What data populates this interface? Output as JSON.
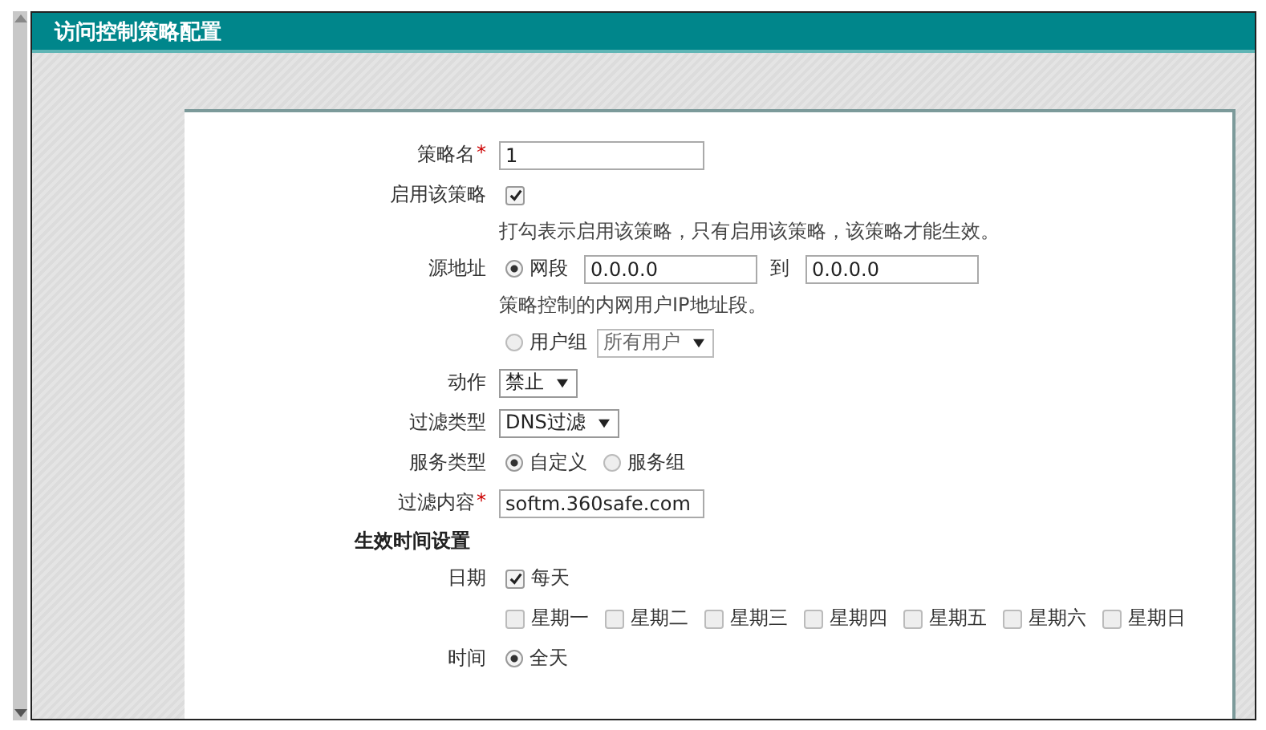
{
  "window": {
    "title": "访问控制策略配置"
  },
  "form": {
    "rows": [
      {
        "kind": "text_input",
        "label": "策略名",
        "required_mark": "*",
        "value": "1"
      },
      {
        "kind": "checkbox",
        "label": "启用该策略",
        "checked": true
      },
      {
        "kind": "hint",
        "text": "打勾表示启用该策略，只有启用该策略，该策略才能生效。"
      },
      {
        "kind": "range",
        "label": "源地址",
        "option": {
          "label": "网段",
          "selected": true
        },
        "from": "0.0.0.0",
        "to_label": "到",
        "to": "0.0.0.0"
      },
      {
        "kind": "hint",
        "text": "策略控制的内网用户IP地址段。"
      },
      {
        "kind": "radio_select",
        "option": {
          "label": "用户组",
          "selected": false
        },
        "value": "所有用户"
      },
      {
        "kind": "select",
        "label": "动作",
        "value": "禁止"
      },
      {
        "kind": "select",
        "label": "过滤类型",
        "value": "DNS过滤"
      },
      {
        "kind": "radio_group",
        "label": "服务类型",
        "options": [
          {
            "label": "自定义",
            "selected": true
          },
          {
            "label": "服务组",
            "selected": false
          }
        ]
      },
      {
        "kind": "text_input",
        "label": "过滤内容",
        "required_mark": "*",
        "value": "softm.360safe.com"
      },
      {
        "kind": "section",
        "text": "生效时间设置"
      },
      {
        "kind": "checkbox_list",
        "label": "日期",
        "options": [
          {
            "label": "每天",
            "checked": true
          }
        ]
      },
      {
        "kind": "checkbox_list",
        "options": [
          {
            "label": "星期一",
            "checked": false
          },
          {
            "label": "星期二",
            "checked": false
          },
          {
            "label": "星期三",
            "checked": false
          },
          {
            "label": "星期四",
            "checked": false
          },
          {
            "label": "星期五",
            "checked": false
          },
          {
            "label": "星期六",
            "checked": false
          },
          {
            "label": "星期日",
            "checked": false
          }
        ]
      },
      {
        "kind": "radio_group",
        "label": "时间",
        "options": [
          {
            "label": "全天",
            "selected": true
          }
        ]
      }
    ]
  }
}
